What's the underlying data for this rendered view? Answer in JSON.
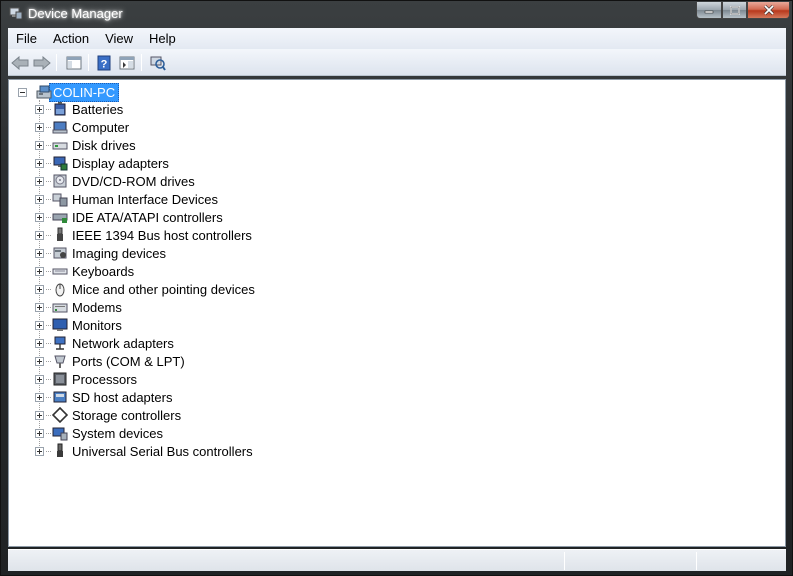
{
  "window": {
    "title": "Device Manager",
    "caption_buttons": [
      "minimize",
      "maximize",
      "close"
    ]
  },
  "menu": {
    "items": [
      "File",
      "Action",
      "View",
      "Help"
    ]
  },
  "toolbar": {
    "buttons": [
      "back-arrow-icon",
      "forward-arrow-icon",
      "show-hide-console-tree-icon",
      "help-icon",
      "properties-icon",
      "scan-hardware-icon"
    ]
  },
  "tree": {
    "root": "COLIN-PC",
    "nodes": [
      "Batteries",
      "Computer",
      "Disk drives",
      "Display adapters",
      "DVD/CD-ROM drives",
      "Human Interface Devices",
      "IDE ATA/ATAPI controllers",
      "IEEE 1394 Bus host controllers",
      "Imaging devices",
      "Keyboards",
      "Mice and other pointing devices",
      "Modems",
      "Monitors",
      "Network adapters",
      "Ports (COM & LPT)",
      "Processors",
      "SD host adapters",
      "Storage controllers",
      "System devices",
      "Universal Serial Bus controllers"
    ]
  },
  "colors": {
    "selection": "#3399ff",
    "frame": "#2b2e30"
  }
}
